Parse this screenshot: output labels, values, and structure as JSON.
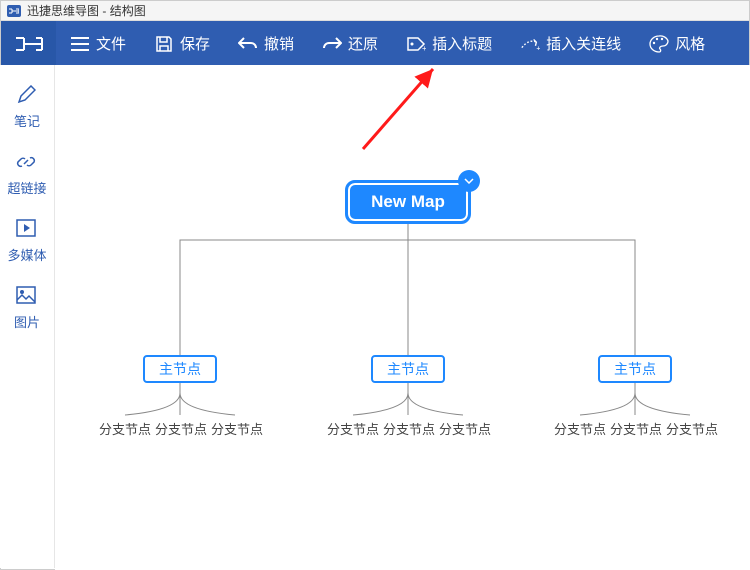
{
  "titlebar": {
    "app": "迅捷思维导图",
    "doc": "结构图"
  },
  "toolbar": {
    "file": "文件",
    "save": "保存",
    "undo": "撤销",
    "redo": "还原",
    "insert_title": "插入标题",
    "insert_relation": "插入关连线",
    "style": "风格"
  },
  "sidebar": {
    "note": "笔记",
    "hyperlink": "超链接",
    "multimedia": "多媒体",
    "image": "图片"
  },
  "map": {
    "root": "New Map",
    "main_nodes": [
      "主节点",
      "主节点",
      "主节点"
    ],
    "leaf_label": "分支节点"
  },
  "colors": {
    "accent": "#1e88ff",
    "toolbar": "#2f5db1"
  }
}
